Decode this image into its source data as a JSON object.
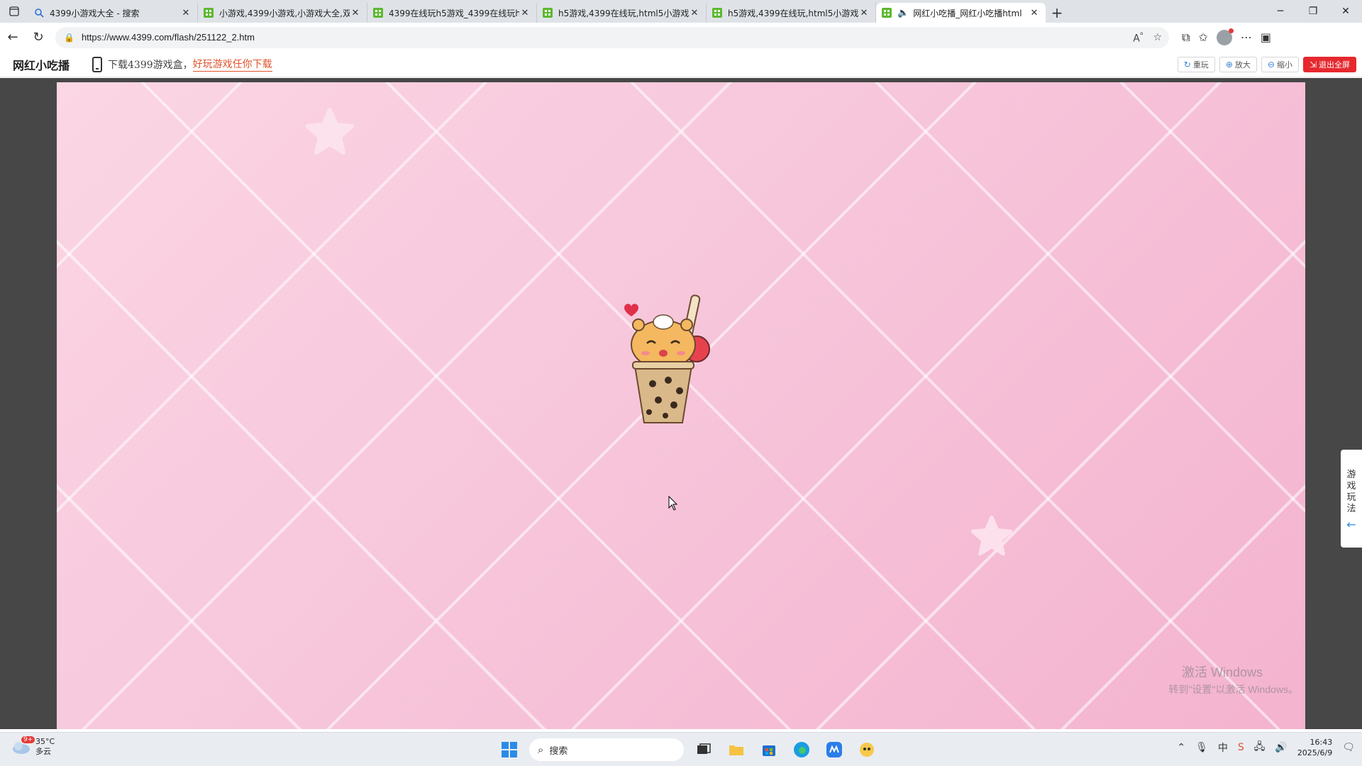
{
  "browser": {
    "tabs": [
      {
        "title": "4399小游戏大全 - 搜索",
        "active": false,
        "favicon": "search-icon"
      },
      {
        "title": "小游戏,4399小游戏,小游戏大全,双",
        "active": false,
        "favicon": "4399-icon"
      },
      {
        "title": "4399在线玩h5游戏_4399在线玩h",
        "active": false,
        "favicon": "4399-icon"
      },
      {
        "title": "h5游戏,4399在线玩,html5小游戏,",
        "active": false,
        "favicon": "4399-icon"
      },
      {
        "title": "h5游戏,4399在线玩,html5小游戏,",
        "active": false,
        "favicon": "4399-icon"
      },
      {
        "title": "网红小吃播_网红小吃播html",
        "active": true,
        "favicon": "4399-icon"
      }
    ],
    "url": "https://www.4399.com/flash/251122_2.htm"
  },
  "site": {
    "title": "网红小吃播",
    "download_text": "下载4399游戏盒，",
    "download_link": "好玩游戏任你下载",
    "buttons": {
      "replay": "重玩",
      "zoom_in": "放大",
      "zoom_out": "缩小",
      "exit_fullscreen": "退出全屏"
    }
  },
  "game": {
    "side_help": [
      "游",
      "戏",
      "玩",
      "法"
    ],
    "watermark_title": "激活 Windows",
    "watermark_sub": "转到\"设置\"以激活 Windows。"
  },
  "taskbar": {
    "weather_temp": "35°C",
    "weather_desc": "多云",
    "weather_badge": "9+",
    "search_placeholder": "搜索",
    "time": "16:43",
    "date": "2025/6/9",
    "ime": "中"
  },
  "colors": {
    "accent_red": "#e6282e",
    "link_orange": "#e0542e",
    "game_pink": "#f7c6db"
  }
}
